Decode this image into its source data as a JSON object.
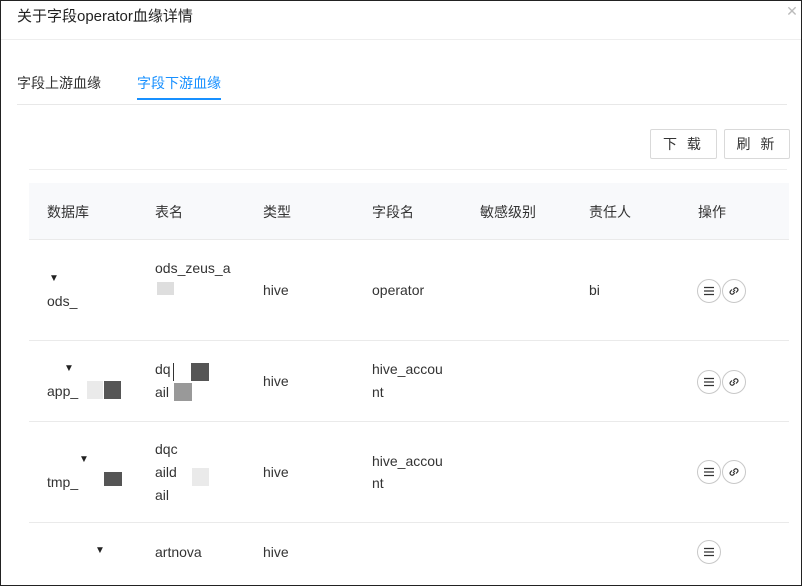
{
  "dialog": {
    "title": "关于字段operator血缘详情",
    "close_icon": "close-icon"
  },
  "tabs": [
    {
      "label": "字段上游血缘",
      "active": false
    },
    {
      "label": "字段下游血缘",
      "active": true
    }
  ],
  "toolbar": {
    "download_label": "下 载",
    "refresh_label": "刷 新"
  },
  "colors": {
    "accent": "#1890ff",
    "header_bg": "#f8f9fb"
  },
  "table": {
    "columns": [
      "数据库",
      "表名",
      "类型",
      "字段名",
      "敏感级别",
      "责任人",
      "操作"
    ],
    "rows": [
      {
        "db": "ods_",
        "table_lines": [
          "ods_zeus_a"
        ],
        "type": "hive",
        "field_lines": [
          "operator"
        ],
        "sensitivity": "",
        "owner": "bi",
        "ops": [
          "detail-icon",
          "link-icon"
        ]
      },
      {
        "db": "app_",
        "table_lines": [
          "dq",
          "ail"
        ],
        "type": "hive",
        "field_lines": [
          "hive_accou",
          "nt"
        ],
        "sensitivity": "",
        "owner": "",
        "ops": [
          "detail-icon",
          "link-icon"
        ]
      },
      {
        "db": "tmp_",
        "table_lines": [
          "dqc",
          "aild",
          "ail"
        ],
        "type": "hive",
        "field_lines": [
          "hive_accou",
          "nt"
        ],
        "sensitivity": "",
        "owner": "",
        "ops": [
          "detail-icon",
          "link-icon"
        ]
      },
      {
        "db": "",
        "table_lines": [
          "artnova"
        ],
        "type": "hive",
        "field_lines": [],
        "sensitivity": "",
        "owner": "",
        "ops": [
          "detail-icon"
        ]
      }
    ]
  }
}
